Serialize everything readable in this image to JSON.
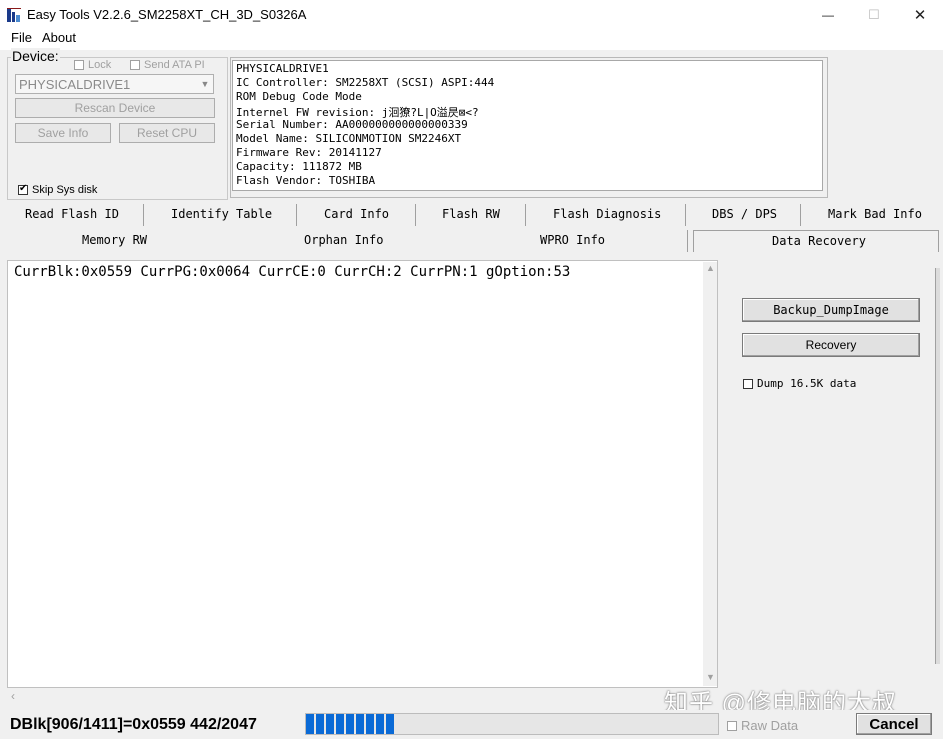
{
  "window": {
    "title": "Easy Tools V2.2.6_SM2258XT_CH_3D_S0326A",
    "minimize_glyph": "—",
    "maximize_glyph": "☐",
    "close_glyph": "✕"
  },
  "menu": {
    "file": "File",
    "about": "About"
  },
  "device": {
    "group_label": "Device:",
    "lock_label": "Lock",
    "send_ata_label": "Send ATA PI",
    "selected_drive": "PHYSICALDRIVE1",
    "rescan_label": "Rescan Device",
    "save_info_label": "Save Info",
    "reset_cpu_label": "Reset CPU",
    "skip_sys_disk_label": "Skip Sys disk",
    "skip_sys_disk_checked": true
  },
  "info": {
    "lines": [
      "PHYSICALDRIVE1",
      "IC Controller: SM2258XT (SCSI) ASPI:444",
      "ROM Debug Code Mode",
      "Internel FW revision: j洄獠?L|O溢昃⊠<?",
      "Serial Number: AA000000000000000339",
      "Model Name: SILICONMOTION SM2246XT",
      "Firmware Rev: 20141127",
      "Capacity: 111872 MB",
      "Flash Vendor: TOSHIBA"
    ]
  },
  "tabs": {
    "row1": [
      "Read Flash ID",
      "Identify Table",
      "Card Info",
      "Flash RW",
      "Flash Diagnosis",
      "DBS / DPS",
      "Mark Bad Info"
    ],
    "row2": [
      "Memory RW",
      "Orphan Info",
      "WPRO Info",
      "Data Recovery"
    ],
    "active": "Data Recovery"
  },
  "recovery": {
    "log_text": "CurrBlk:0x0559 CurrPG:0x0064 CurrCE:0 CurrCH:2 CurrPN:1 gOption:53",
    "backup_label": "Backup_DumpImage",
    "recovery_label": "Recovery",
    "dump_label": "Dump 16.5K data",
    "dump_checked": false
  },
  "watermark": "知乎 @修电脑的大叔",
  "status": {
    "text": "DBlk[906/1411]=0x0559  442/2047",
    "progress_fraction": 0.216,
    "progress_color": "#0a6ad6",
    "raw_data_label": "Raw Data",
    "cancel_label": "Cancel"
  }
}
